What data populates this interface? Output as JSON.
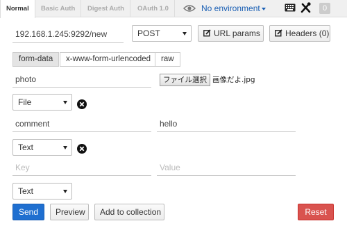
{
  "tabs": [
    "Normal",
    "Basic Auth",
    "Digest Auth",
    "OAuth 1.0"
  ],
  "environment": "No environment",
  "history_count": "0",
  "request": {
    "url": "192.168.1.245:9292/new",
    "method": "POST",
    "url_params_label": "URL params",
    "headers_label": "Headers (0)"
  },
  "body_tabs": [
    "form-data",
    "x-www-form-urlencoded",
    "raw"
  ],
  "form_rows": [
    {
      "key": "photo",
      "type": "File",
      "file_button": "ファイル選択",
      "file_name": "画像だよ.jpg"
    },
    {
      "key": "comment",
      "type": "Text",
      "value": "hello"
    },
    {
      "key_placeholder": "Key",
      "value_placeholder": "Value",
      "type": "Text"
    }
  ],
  "actions": {
    "send": "Send",
    "preview": "Preview",
    "add_to_collection": "Add to collection",
    "reset": "Reset"
  },
  "colors": {
    "send": "#1f6fd0",
    "reset": "#d9534f",
    "link": "#1a5fb4"
  }
}
